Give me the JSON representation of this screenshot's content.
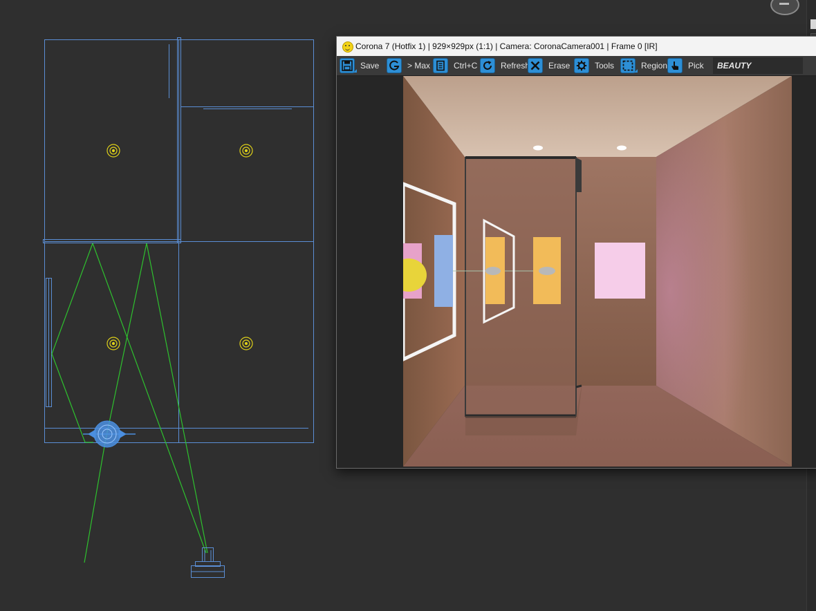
{
  "viewport": {
    "name": "3ds Max Top viewport (scene wireframe)",
    "colors": {
      "background": "#2f2f2f",
      "walls": "#5b8fd6",
      "camera_frustum": "#2ec22e",
      "lights": "#e0d219",
      "camera": "#4b8fe0"
    }
  },
  "vfb": {
    "title": "Corona 7 (Hotfix 1) | 929×929px (1:1) | Camera: CoronaCamera001 | Frame 0 [IR]",
    "toolbar": {
      "save_label": "Save",
      "max_label": "> Max",
      "copy_label": "Ctrl+C",
      "refresh_label": "Refresh",
      "erase_label": "Erase",
      "tools_label": "Tools",
      "region_label": "Region",
      "pick_label": "Pick",
      "channel_label": "BEAUTY"
    },
    "icons": [
      "save-icon",
      "max-icon",
      "copy-icon",
      "refresh-icon",
      "erase-icon",
      "tools-icon",
      "region-icon",
      "pick-icon"
    ],
    "accent": "#2d8fd6"
  }
}
